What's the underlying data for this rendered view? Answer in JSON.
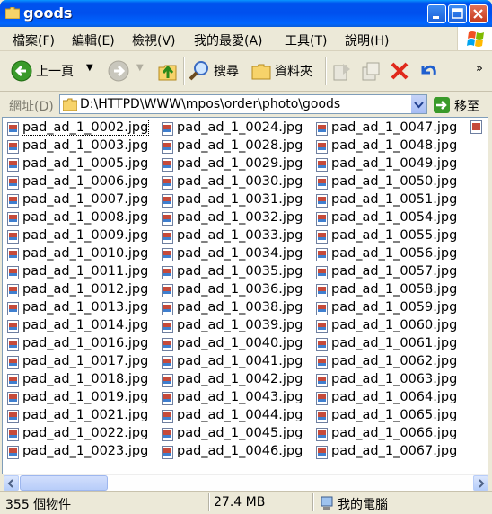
{
  "window": {
    "title": "goods"
  },
  "menu": [
    "檔案(F)",
    "編輯(E)",
    "檢視(V)",
    "我的最愛(A)",
    "工具(T)",
    "說明(H)"
  ],
  "toolbar": {
    "back_label": "上一頁",
    "search_label": "搜尋",
    "folders_label": "資料夾"
  },
  "address": {
    "label": "網址(D)",
    "path": "D:\\HTTPD\\WWW\\mpos\\order\\photo\\goods",
    "go_label": "移至"
  },
  "files": {
    "col1": [
      "pad_ad_1_0002.jpg",
      "pad_ad_1_0003.jpg",
      "pad_ad_1_0005.jpg",
      "pad_ad_1_0006.jpg",
      "pad_ad_1_0007.jpg",
      "pad_ad_1_0008.jpg",
      "pad_ad_1_0009.jpg",
      "pad_ad_1_0010.jpg",
      "pad_ad_1_0011.jpg",
      "pad_ad_1_0012.jpg",
      "pad_ad_1_0013.jpg",
      "pad_ad_1_0014.jpg",
      "pad_ad_1_0016.jpg",
      "pad_ad_1_0017.jpg",
      "pad_ad_1_0018.jpg",
      "pad_ad_1_0019.jpg",
      "pad_ad_1_0021.jpg",
      "pad_ad_1_0022.jpg",
      "pad_ad_1_0023.jpg"
    ],
    "col2": [
      "pad_ad_1_0024.jpg",
      "pad_ad_1_0028.jpg",
      "pad_ad_1_0029.jpg",
      "pad_ad_1_0030.jpg",
      "pad_ad_1_0031.jpg",
      "pad_ad_1_0032.jpg",
      "pad_ad_1_0033.jpg",
      "pad_ad_1_0034.jpg",
      "pad_ad_1_0035.jpg",
      "pad_ad_1_0036.jpg",
      "pad_ad_1_0038.jpg",
      "pad_ad_1_0039.jpg",
      "pad_ad_1_0040.jpg",
      "pad_ad_1_0041.jpg",
      "pad_ad_1_0042.jpg",
      "pad_ad_1_0043.jpg",
      "pad_ad_1_0044.jpg",
      "pad_ad_1_0045.jpg",
      "pad_ad_1_0046.jpg"
    ],
    "col3": [
      "pad_ad_1_0047.jpg",
      "pad_ad_1_0048.jpg",
      "pad_ad_1_0049.jpg",
      "pad_ad_1_0050.jpg",
      "pad_ad_1_0051.jpg",
      "pad_ad_1_0054.jpg",
      "pad_ad_1_0055.jpg",
      "pad_ad_1_0056.jpg",
      "pad_ad_1_0057.jpg",
      "pad_ad_1_0058.jpg",
      "pad_ad_1_0059.jpg",
      "pad_ad_1_0060.jpg",
      "pad_ad_1_0061.jpg",
      "pad_ad_1_0062.jpg",
      "pad_ad_1_0063.jpg",
      "pad_ad_1_0064.jpg",
      "pad_ad_1_0065.jpg",
      "pad_ad_1_0066.jpg",
      "pad_ad_1_0067.jpg"
    ]
  },
  "status": {
    "count": "355 個物件",
    "size": "27.4 MB",
    "location": "我的電腦"
  },
  "colors": {
    "titlebar": "#0054e3",
    "window_bg": "#ece9d8",
    "close_button": "#d64626"
  }
}
